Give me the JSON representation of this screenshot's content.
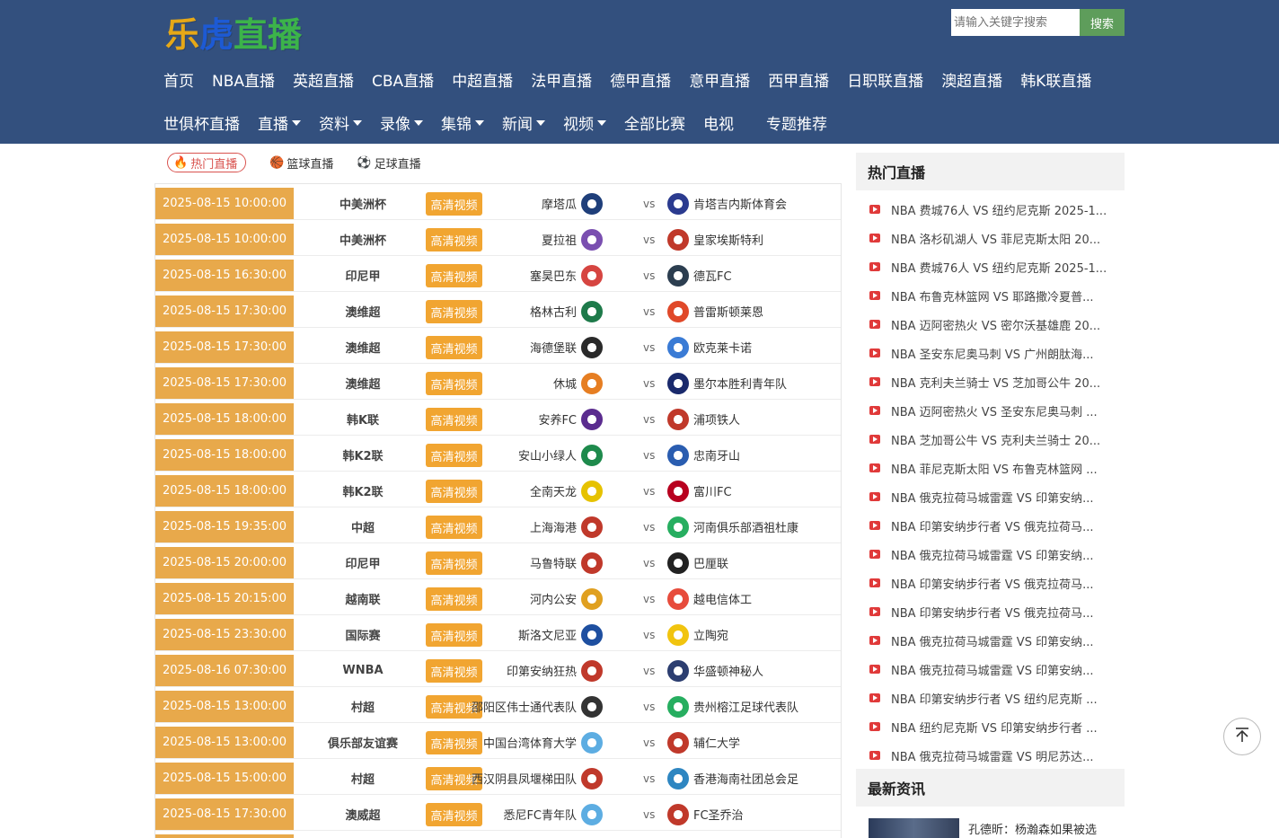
{
  "logo": {
    "chars": [
      "乐",
      "虎",
      "直",
      "播"
    ],
    "colors": [
      "#e6a817",
      "#1d5ad4",
      "#3cb34a",
      "#3cb34a"
    ]
  },
  "search": {
    "placeholder": "请输入关键字搜索",
    "button": "搜索"
  },
  "nav": {
    "row1": [
      "首页",
      "NBA直播",
      "英超直播",
      "CBA直播",
      "中超直播",
      "法甲直播",
      "德甲直播",
      "意甲直播",
      "西甲直播",
      "日职联直播",
      "澳超直播",
      "韩K联直播"
    ],
    "row2": [
      {
        "label": "世俱杯直播",
        "dropdown": false
      },
      {
        "label": "直播",
        "dropdown": true
      },
      {
        "label": "资料",
        "dropdown": true
      },
      {
        "label": "录像",
        "dropdown": true
      },
      {
        "label": "集锦",
        "dropdown": true
      },
      {
        "label": "新闻",
        "dropdown": true
      },
      {
        "label": "视频",
        "dropdown": true
      },
      {
        "label": "全部比赛",
        "dropdown": false
      },
      {
        "label": "电视",
        "dropdown": false
      },
      {
        "label": "专题推荐",
        "dropdown": false
      }
    ]
  },
  "tabs": [
    {
      "label": "热门直播",
      "icon": "fire-icon",
      "active": true
    },
    {
      "label": "篮球直播",
      "icon": "basketball-icon",
      "active": false
    },
    {
      "label": "足球直播",
      "icon": "soccer-ball-icon",
      "active": false
    }
  ],
  "hd_label": "高清视频",
  "vs_label": "vs",
  "matches": [
    {
      "time": "2025-08-15 10:00:00",
      "league": "中美洲杯",
      "home": "摩塔瓜",
      "away": "肯塔吉内斯体育会",
      "home_color": "#1f3f7a",
      "away_color": "#2b3b8f"
    },
    {
      "time": "2025-08-15 10:00:00",
      "league": "中美洲杯",
      "home": "夏拉祖",
      "away": "皇家埃斯特利",
      "home_color": "#7a4fb0",
      "away_color": "#c0392b"
    },
    {
      "time": "2025-08-15 16:30:00",
      "league": "印尼甲",
      "home": "塞昊巴东",
      "away": "德瓦FC",
      "home_color": "#d64541",
      "away_color": "#2c3e50"
    },
    {
      "time": "2025-08-15 17:30:00",
      "league": "澳维超",
      "home": "格林古利",
      "away": "普雷斯顿莱恩",
      "home_color": "#1e7a4a",
      "away_color": "#e0492a"
    },
    {
      "time": "2025-08-15 17:30:00",
      "league": "澳维超",
      "home": "海德堡联",
      "away": "欧克莱卡诺",
      "home_color": "#2a2a2a",
      "away_color": "#3a7bd5"
    },
    {
      "time": "2025-08-15 17:30:00",
      "league": "澳维超",
      "home": "休城",
      "away": "墨尔本胜利青年队",
      "home_color": "#e67e22",
      "away_color": "#1a2a6c"
    },
    {
      "time": "2025-08-15 18:00:00",
      "league": "韩K联",
      "home": "安养FC",
      "away": "浦项铁人",
      "home_color": "#5b2c8f",
      "away_color": "#c0392b"
    },
    {
      "time": "2025-08-15 18:00:00",
      "league": "韩K2联",
      "home": "安山小绿人",
      "away": "忠南牙山",
      "home_color": "#1e8a4c",
      "away_color": "#2a5db0"
    },
    {
      "time": "2025-08-15 18:00:00",
      "league": "韩K2联",
      "home": "全南天龙",
      "away": "富川FC",
      "home_color": "#e6c200",
      "away_color": "#b8001f"
    },
    {
      "time": "2025-08-15 19:35:00",
      "league": "中超",
      "home": "上海海港",
      "away": "河南俱乐部酒祖杜康",
      "home_color": "#c0392b",
      "away_color": "#27ae60"
    },
    {
      "time": "2025-08-15 20:00:00",
      "league": "印尼甲",
      "home": "马鲁特联",
      "away": "巴厘联",
      "home_color": "#c0392b",
      "away_color": "#222222"
    },
    {
      "time": "2025-08-15 20:15:00",
      "league": "越南联",
      "home": "河内公安",
      "away": "越电信体工",
      "home_color": "#e0a020",
      "away_color": "#e74c3c"
    },
    {
      "time": "2025-08-15 23:30:00",
      "league": "国际赛",
      "home": "斯洛文尼亚",
      "away": "立陶宛",
      "home_color": "#1e4fa0",
      "away_color": "#f1c40f"
    },
    {
      "time": "2025-08-16 07:30:00",
      "league": "WNBA",
      "home": "印第安纳狂热",
      "away": "华盛顿神秘人",
      "home_color": "#c0392b",
      "away_color": "#2c3e70"
    },
    {
      "time": "2025-08-15 13:00:00",
      "league": "村超",
      "home": "邵阳区伟士通代表队",
      "away": "贵州榕江足球代表队",
      "home_color": "#333333",
      "away_color": "#27ae60"
    },
    {
      "time": "2025-08-15 13:00:00",
      "league": "俱乐部友谊赛",
      "home": "中国台湾体育大学",
      "away": "辅仁大学",
      "home_color": "#5dade2",
      "away_color": "#c0392b"
    },
    {
      "time": "2025-08-15 15:00:00",
      "league": "村超",
      "home": "西汉阴县凤堰梯田队",
      "away": "香港海南社团总会足",
      "home_color": "#c0392b",
      "away_color": "#2e86c1"
    },
    {
      "time": "2025-08-15 17:30:00",
      "league": "澳威超",
      "home": "悉尼FC青年队",
      "away": "FC圣乔治",
      "home_color": "#5dade2",
      "away_color": "#c0392b"
    }
  ],
  "sidebar": {
    "hot_title": "热门直播",
    "hot_items": [
      "NBA 费城76人 VS 纽约尼克斯 2025-1...",
      "NBA 洛杉矶湖人 VS 菲尼克斯太阳 20...",
      "NBA 费城76人 VS 纽约尼克斯 2025-1...",
      "NBA 布鲁克林篮网 VS 耶路撒冷夏普...",
      "NBA 迈阿密热火 VS 密尔沃基雄鹿 20...",
      "NBA 圣安东尼奥马刺 VS 广州朗肽海...",
      "NBA 克利夫兰骑士 VS 芝加哥公牛 20...",
      "NBA 迈阿密热火 VS 圣安东尼奥马刺 ...",
      "NBA 芝加哥公牛 VS 克利夫兰骑士 20...",
      "NBA 菲尼克斯太阳 VS 布鲁克林篮网 ...",
      "NBA 俄克拉荷马城雷霆 VS 印第安纳...",
      "NBA 印第安纳步行者 VS 俄克拉荷马...",
      "NBA 俄克拉荷马城雷霆 VS 印第安纳...",
      "NBA 印第安纳步行者 VS 俄克拉荷马...",
      "NBA 印第安纳步行者 VS 俄克拉荷马...",
      "NBA 俄克拉荷马城雷霆 VS 印第安纳...",
      "NBA 俄克拉荷马城雷霆 VS 印第安纳...",
      "NBA 印第安纳步行者 VS 纽约尼克斯 ...",
      "NBA 纽约尼克斯 VS 印第安纳步行者 ...",
      "NBA 俄克拉荷马城雷霆 VS 明尼苏达..."
    ],
    "news_title": "最新资讯",
    "news_first": "孔德昕：杨瀚森如果被选"
  },
  "back_to_top": "back-to-top-icon"
}
